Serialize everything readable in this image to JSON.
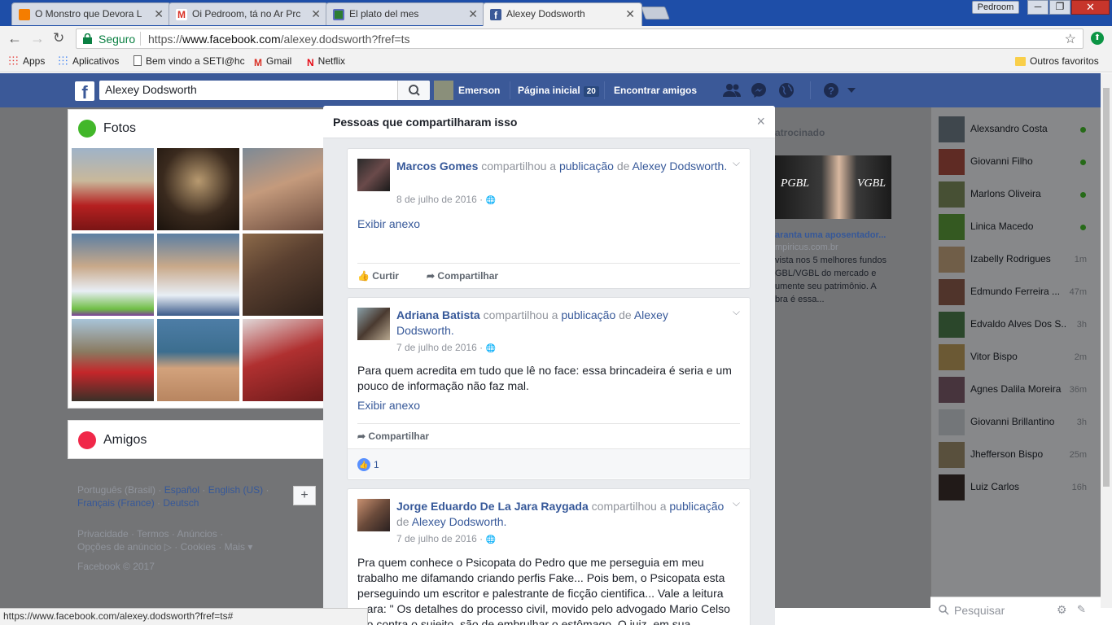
{
  "browser": {
    "tabs": [
      {
        "title": "O Monstro que Devora L",
        "favicon_color": "#f57d00"
      },
      {
        "title": "Oi Pedroom, tá no Ar Prc",
        "favicon_color": "#d93025"
      },
      {
        "title": "El plato del mes",
        "favicon_color": "#2e7d32"
      },
      {
        "title": "Alexey Dodsworth",
        "favicon_color": "#3b5998"
      }
    ],
    "profile_name": "Pedroom",
    "secure_label": "Seguro",
    "url_prefix": "https://",
    "url_domain": "www.facebook.com",
    "url_path": "/alexey.dodsworth?fref=ts",
    "bookmarks": [
      "Apps",
      "Aplicativos",
      "Bem vindo a SETI@hc",
      "Gmail",
      "Netflix"
    ],
    "other_bookmarks": "Outros favoritos",
    "status_url": "https://www.facebook.com/alexey.dodsworth?fref=ts#"
  },
  "fb_header": {
    "search_value": "Alexey Dodsworth",
    "user_name": "Emerson",
    "home_label": "Página inicial",
    "home_count": "20",
    "find_friends": "Encontrar amigos"
  },
  "left": {
    "photos_title": "Fotos",
    "friends_title": "Amigos",
    "languages_line1": [
      "Português (Brasil)",
      "Español",
      "English (US)"
    ],
    "languages_line2": [
      "Français (France)",
      "Deutsch"
    ],
    "links_line1": "Privacidade · Termos · Anúncios ·",
    "links_line2": "Opções de anúncio ▷ · Cookies · Mais ▾",
    "copyright": "Facebook © 2017"
  },
  "ads": {
    "heading": "atrocinado",
    "image_text_left": "PGBL",
    "image_text_right": "VGBL",
    "title": "aranta uma aposentador...",
    "domain": "mpiricus.com.br",
    "text": "vista nos 5 melhores fundos GBL/VGBL do mercado e umente seu patrimônio. A bra é essa..."
  },
  "chat": {
    "contacts": [
      {
        "name": "Alexsandro Costa",
        "status": "online"
      },
      {
        "name": "Giovanni Filho",
        "status": "online"
      },
      {
        "name": "Marlons Oliveira",
        "status": "online"
      },
      {
        "name": "Linica Macedo",
        "status": "online"
      },
      {
        "name": "Izabelly Rodrigues",
        "status": "1m"
      },
      {
        "name": "Edmundo Ferreira ...",
        "status": "47m"
      },
      {
        "name": "Edvaldo Alves Dos S...",
        "status": "3h"
      },
      {
        "name": "Vitor Bispo",
        "status": "2m"
      },
      {
        "name": "Agnes Dalila Moreira",
        "status": "36m"
      },
      {
        "name": "Giovanni Brillantino",
        "status": "3h"
      },
      {
        "name": "Jhefferson Bispo",
        "status": "25m"
      },
      {
        "name": "Luiz Carlos",
        "status": "16h"
      }
    ],
    "search_placeholder": "Pesquisar"
  },
  "modal": {
    "title": "Pessoas que compartilharam isso",
    "close": "×",
    "shared_text": "compartilhou a",
    "publication": "publicação",
    "of": "de",
    "target": "Alexey Dodsworth.",
    "posts": [
      {
        "author": "Marcos Gomes",
        "date": "8 de julho de 2016 ·",
        "attachment": "Exibir anexo",
        "like": "Curtir",
        "share": "Compartilhar"
      },
      {
        "author": "Adriana Batista",
        "date": "7 de julho de 2016 ·",
        "body": "Para quem acredita em tudo que lê no face: essa brincadeira é seria e um pouco de informação não faz mal.",
        "attachment": "Exibir anexo",
        "share": "Compartilhar",
        "like_count": "1"
      },
      {
        "author": "Jorge Eduardo De La Jara Raygada",
        "date": "7 de julho de 2016 ·",
        "body": "Pra quem conhece o Psicopata do Pedro que me perseguia em meu trabalho me difamando criando perfis Fake... Pois bem, o Psicopata esta perseguindo um escritor e palestrante de ficção cientifica... Vale a leitura ...ara: \" Os detalhes do processo civil, movido pelo advogado Mario Celso ...o contra o sujeito, são de embrulhar o estômago. O juiz, em sua"
      }
    ]
  }
}
